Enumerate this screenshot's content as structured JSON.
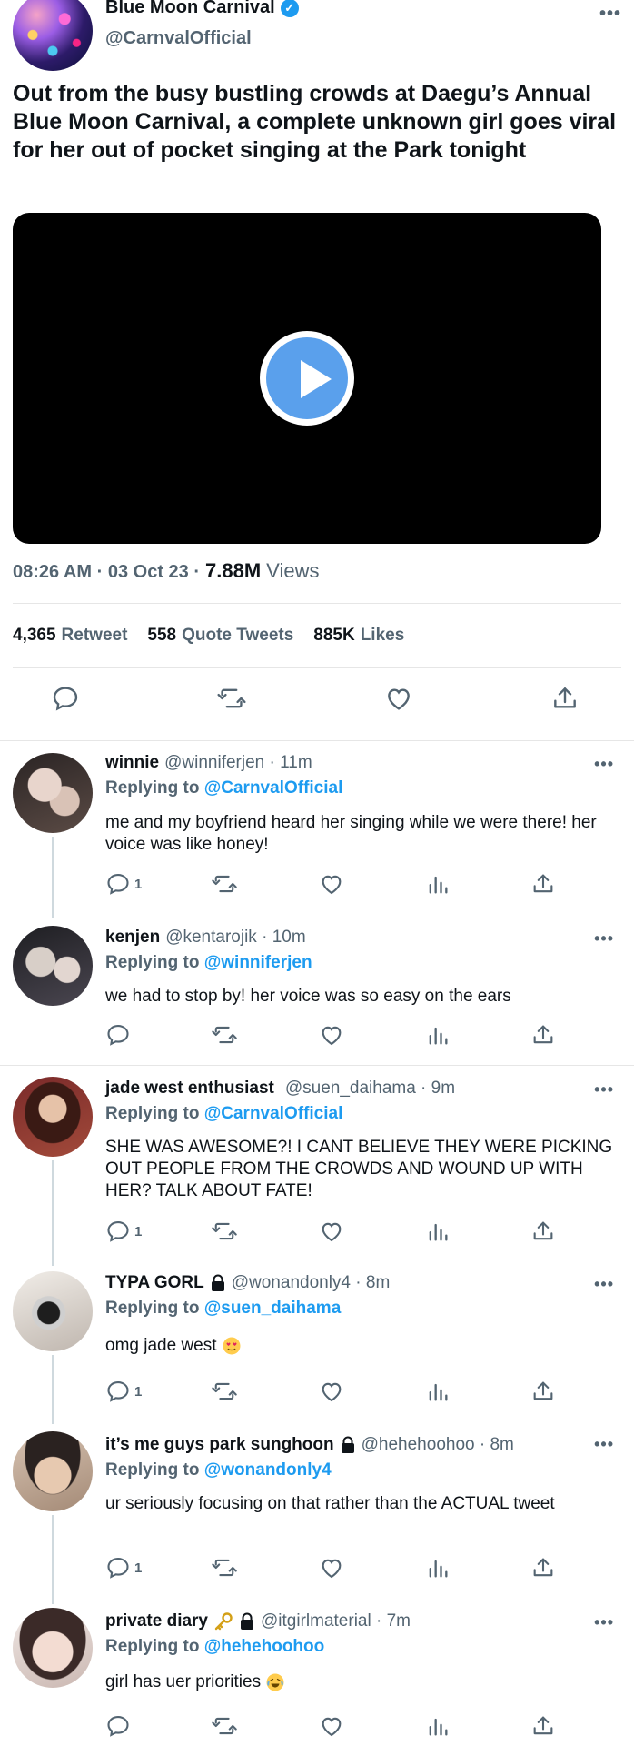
{
  "main_tweet": {
    "author_name": "Blue Moon Carnival",
    "author_handle": "@CarnvalOfficial",
    "text": "Out from the busy bustling crowds at Daegu’s Annual Blue Moon Carnival, a complete unknown girl goes viral for her out of pocket singing at the Park tonight",
    "time": "08:26 AM · 03 Oct 23 ·",
    "views_count": "7.88M",
    "views_label": "Views",
    "retweets_count": "4,365",
    "retweets_label": "Retweet",
    "quotes_count": "558",
    "quotes_label": "Quote Tweets",
    "likes_count": "885K",
    "likes_label": "Likes",
    "more": "•••"
  },
  "replies": [
    {
      "name": "winnie",
      "handle": "@winniferjen · 11m",
      "replying_label": "Replying to",
      "replying_to": "@CarnvalOfficial",
      "text": "me and my boyfriend heard her singing while we were there! her voice was like honey!",
      "reply_count": "1",
      "more": "•••"
    },
    {
      "name": "kenjen",
      "handle": "@kentarojik · 10m",
      "replying_label": "Replying to",
      "replying_to": "@winniferjen",
      "text": "we had to stop by! her voice was so easy on the ears",
      "reply_count": "",
      "more": "•••"
    },
    {
      "name": "jade west enthusiast",
      "handle": "@suen_daihama · 9m",
      "replying_label": "Replying to",
      "replying_to": "@CarnvalOfficial",
      "text": "SHE WAS AWESOME?! I CANT BELIEVE THEY WERE PICKING OUT PEOPLE FROM THE CROWDS AND WOUND UP WITH HER? TALK ABOUT FATE!",
      "reply_count": "1",
      "more": "•••"
    },
    {
      "name": "TYPA GORL",
      "handle": "@wonandonly4 · 8m",
      "replying_label": "Replying to",
      "replying_to": "@suen_daihama",
      "text": "omg jade west",
      "reply_count": "1",
      "more": "•••"
    },
    {
      "name": "it’s me guys park sunghoon",
      "handle": "@hehehoohoo · 8m",
      "replying_label": "Replying to",
      "replying_to": "@wonandonly4",
      "text": "ur seriously focusing on that rather than the ACTUAL tweet",
      "reply_count": "1",
      "more": "•••"
    },
    {
      "name": "private diary",
      "handle": "@itgirlmaterial · 7m",
      "replying_label": "Replying to",
      "replying_to": "@hehehoohoo",
      "text": "girl has uer priorities",
      "reply_count": "",
      "more": "•••"
    }
  ]
}
